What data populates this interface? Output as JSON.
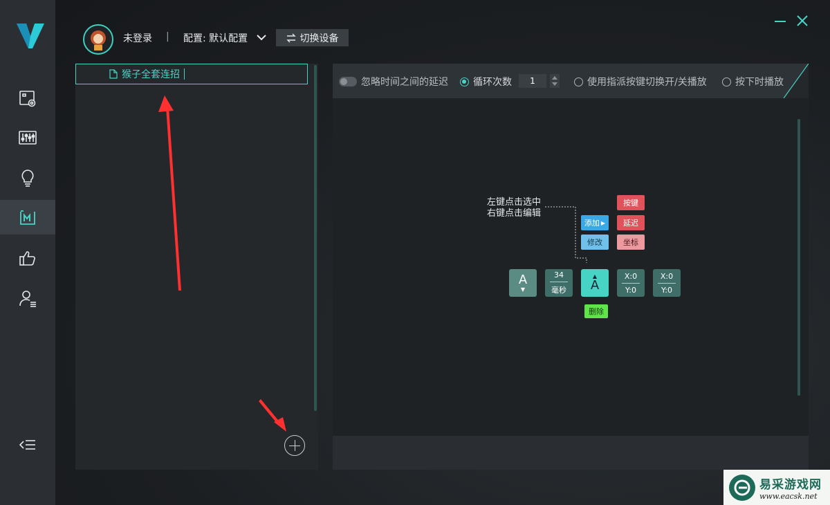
{
  "header": {
    "login_status": "未登录",
    "separator": "|",
    "config_label": "配置: 默认配置",
    "switch_device": "切换设备"
  },
  "macro_list": {
    "items": [
      {
        "name": "猴子全套连招"
      }
    ]
  },
  "toolbar": {
    "ignore_delay": "忽略时间之间的延迟",
    "loop_count_label": "循环次数",
    "loop_count_value": "1",
    "toggle_with_key": "使用指派按键切换开/关播放",
    "play_while_pressed": "按下时播放"
  },
  "demo": {
    "hint_line1": "左键点击选中",
    "hint_line2": "右键点击编辑",
    "add": "添加",
    "modify": "修改",
    "key_chip": "按键",
    "delay_chip": "延迟",
    "coord_chip": "坐标",
    "delete": "删除",
    "key_a_left": "A",
    "delay_value": "34",
    "delay_unit": "毫秒",
    "key_a_selected": "A",
    "coord1_x": "X:0",
    "coord1_y": "Y:0",
    "coord2_x": "X:0",
    "coord2_y": "Y:0"
  },
  "watermark": {
    "title": "易采游戏网",
    "url": "www.eacsk.net"
  },
  "colors": {
    "accent": "#48d4c4",
    "sidebar": "#2b2f33",
    "chip_red": "#e0535a",
    "chip_blue": "#3aa9e6",
    "chip_green": "#5fe44a",
    "arrow_red": "#ff3030"
  }
}
